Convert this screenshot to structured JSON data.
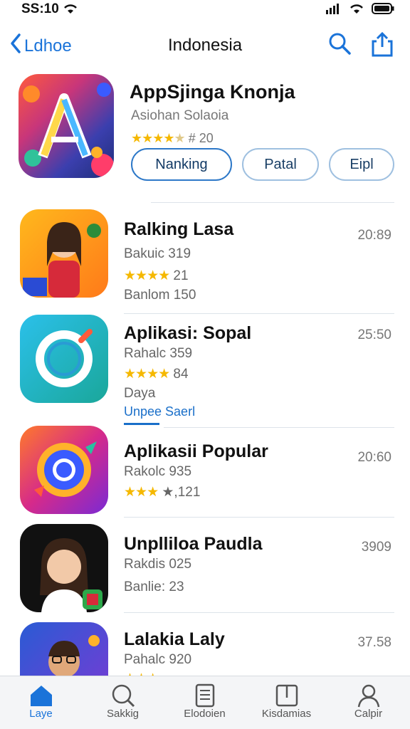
{
  "status": {
    "time": "SS:10"
  },
  "nav": {
    "back_label": "Ldhoe",
    "title": "Indonesia"
  },
  "featured": {
    "title": "AppSjinga Knonja",
    "subtitle": "Asiohan Solaoia",
    "rating_text": "# 20",
    "stars": 4,
    "buttons": [
      "Nanking",
      "Patal",
      "Eipl"
    ]
  },
  "rows": [
    {
      "title": "Ralking Lasa",
      "line1": "Bakuic 319",
      "rating": "21",
      "line3": "Banlom 150",
      "time": "20:89",
      "stars": 4
    },
    {
      "title": "Aplikasi: Sopal",
      "line1": "Rahalc 359",
      "rating": "84",
      "line3": "Daya",
      "link": "Unpee Saerl",
      "time": "25:50",
      "stars": 4
    },
    {
      "title": "Aplikasii Popular",
      "line1": "Rakolc 935",
      "rating": "★,121",
      "time": "20:60",
      "stars": 3
    },
    {
      "title": "Unplliloa Paudla",
      "line1": "Rakdis 025",
      "line3": "Banlie: 23",
      "time": "3909",
      "stars": 0
    },
    {
      "title": "Lalakia Laly",
      "line1": "Pahalc 920",
      "time": "37.58",
      "stars": 3
    }
  ],
  "tabs": [
    "Laye",
    "Sakkig",
    "Elodoien",
    "Kisdamias",
    "Calpir"
  ],
  "colors": {
    "accent": "#1a73d9",
    "star": "#f5b800"
  }
}
